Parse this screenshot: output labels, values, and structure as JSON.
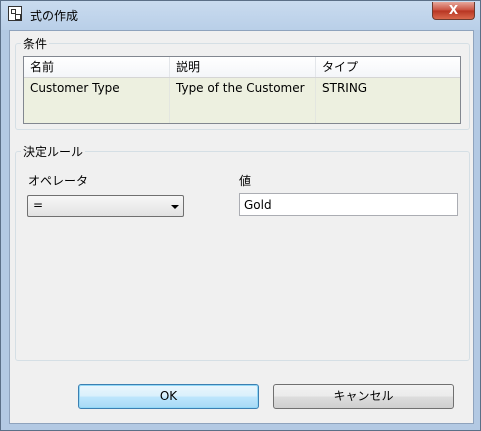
{
  "window": {
    "title": "式の作成",
    "close_label": "X"
  },
  "conditions": {
    "group_label": "条件",
    "columns": [
      "名前",
      "説明",
      "タイプ"
    ],
    "rows": [
      [
        "Customer Type",
        "Type of the Customer",
        "STRING"
      ]
    ]
  },
  "rule": {
    "group_label": "決定ルール",
    "operator_label": "オペレータ",
    "operator_value": "=",
    "value_label": "値",
    "value": "Gold"
  },
  "buttons": {
    "ok": "OK",
    "cancel": "キャンセル"
  },
  "icons": {
    "title": "expression-builder-icon",
    "dropdown": "chevron-down-icon"
  }
}
